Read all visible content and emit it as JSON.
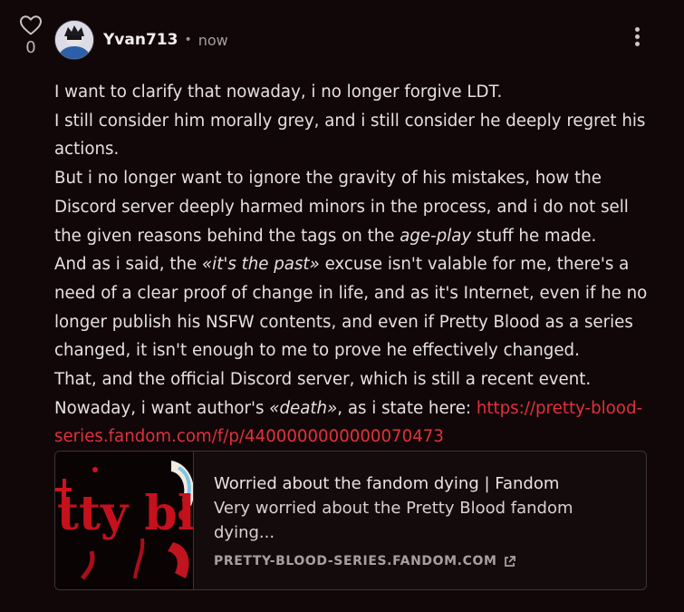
{
  "vote": {
    "icon": "heart-outline-icon",
    "count": "0"
  },
  "header": {
    "username": "Yvan713",
    "separator": "•",
    "time": "now",
    "menu_icon": "more-vertical-icon"
  },
  "post": {
    "lines": [
      "I want to clarify that nowaday, i no longer forgive LDT.",
      "I still consider him morally grey, and i still consider he deeply regret his actions.",
      "But i no longer want to ignore the gravity of his mistakes, how the Discord server deeply harmed minors in the process, and i do not sell the given reasons behind the tags on the ",
      "age-play",
      " stuff he made.",
      "And as i said, the ",
      "«it's the past»",
      " excuse isn't valable for me, there's a need of a clear proof of change in life, and as it's Internet, even if he no longer publish his NSFW contents, and even if Pretty Blood as a series changed, it isn't enough to me to prove he effectively changed.",
      "That, and the official Discord server, which is still a recent event.",
      "Nowaday, i want author's ",
      "«death»",
      ", as i state here: ",
      "https://pretty-blood-series.fandom.com/f/p/4400000000000070473"
    ]
  },
  "preview": {
    "title": "Worried about the fandom dying | Fandom",
    "description": "Very worried about the Pretty Blood fandom dying...",
    "domain": "PRETTY-BLOOD-SERIES.FANDOM.COM",
    "external_icon": "external-link-icon",
    "thumbnail_text": "tty bl"
  },
  "colors": {
    "background": "#110708",
    "link": "#e0313c"
  }
}
